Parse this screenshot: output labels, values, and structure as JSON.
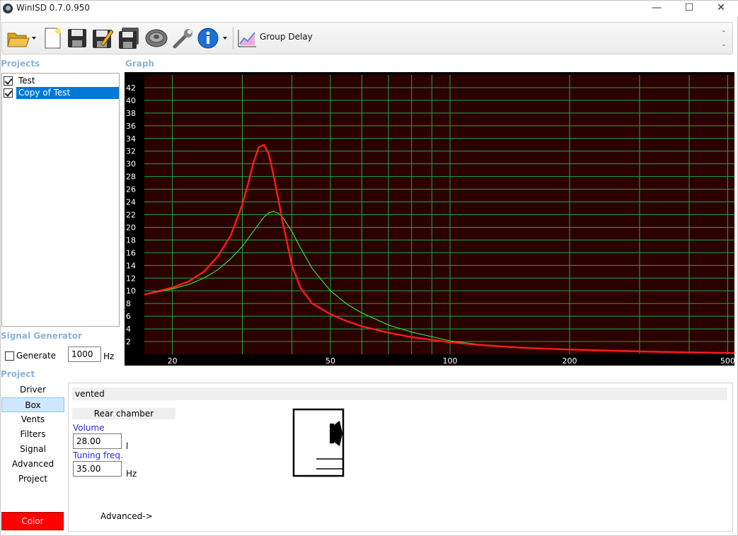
{
  "window": {
    "title": "WinISD 0.7.0.950",
    "minimize": "—",
    "maximize": "☐",
    "close": "✕"
  },
  "toolbar": {
    "group_delay_label": "Group Delay",
    "right_markers": [
      "-",
      "-"
    ],
    "icons": [
      "open-folder-icon",
      "new-document-icon",
      "save-icon",
      "save-as-icon",
      "save-all-icon",
      "speaker-driver-icon",
      "wrench-icon",
      "info-icon",
      "chart-icon"
    ]
  },
  "sections": {
    "projects": "Projects",
    "graph": "Graph",
    "signal_generator": "Signal Generator",
    "project": "Project"
  },
  "projects": [
    {
      "name": "Test",
      "checked": true,
      "selected": false
    },
    {
      "name": "Copy of Test",
      "checked": true,
      "selected": true
    }
  ],
  "signal_generator": {
    "generate_label": "Generate",
    "frequency": "1000",
    "unit": "Hz"
  },
  "nav": [
    "Driver",
    "Box",
    "Vents",
    "Filters",
    "Signal",
    "Advanced",
    "Project"
  ],
  "nav_selected": "Box",
  "color_button": "Color",
  "box": {
    "type": "vented",
    "rear_chamber": "Rear chamber",
    "volume_label": "Volume",
    "volume": "28.00",
    "volume_unit": "l",
    "tuning_label": "Tuning freq.",
    "tuning": "35.00",
    "tuning_unit": "Hz",
    "advanced": "Advanced->"
  },
  "colors": {
    "graph_bg": "#2a0000",
    "grid": "#1fa84a",
    "series_red": "#ff1a1a",
    "series_green": "#33e033",
    "accent": "#0078d7"
  },
  "chart_data": {
    "type": "line",
    "xscale": "log",
    "xlim": [
      17,
      520
    ],
    "ylim": [
      0,
      44
    ],
    "x_ticks": [
      20,
      50,
      100,
      200,
      500
    ],
    "y_ticks": [
      2,
      4,
      6,
      8,
      10,
      12,
      14,
      16,
      18,
      20,
      22,
      24,
      26,
      28,
      30,
      32,
      34,
      36,
      38,
      40,
      42
    ],
    "series": [
      {
        "color": "#ff1a1a",
        "x": [
          17,
          18,
          20,
          22,
          24,
          26,
          28,
          30,
          31,
          32,
          33,
          34,
          35,
          36,
          38,
          40,
          42,
          45,
          50,
          55,
          60,
          70,
          80,
          100,
          120,
          150,
          200,
          300,
          400,
          520
        ],
        "y": [
          9.4,
          9.8,
          10.5,
          11.5,
          13.0,
          15.4,
          18.6,
          23.6,
          26.8,
          30.2,
          32.6,
          33.0,
          31.5,
          28.0,
          20.5,
          14.0,
          10.5,
          8.0,
          6.3,
          5.2,
          4.4,
          3.4,
          2.7,
          1.9,
          1.45,
          1.05,
          0.75,
          0.45,
          0.3,
          0.2
        ]
      },
      {
        "color": "#33e033",
        "x": [
          17,
          18,
          20,
          22,
          24,
          26,
          28,
          30,
          32,
          34,
          35,
          36,
          37,
          38,
          40,
          42,
          45,
          50,
          55,
          60,
          70,
          80,
          100,
          120,
          150,
          200,
          300,
          400,
          520
        ],
        "y": [
          9.4,
          9.7,
          10.3,
          11.0,
          12.0,
          13.3,
          15.0,
          17.0,
          19.4,
          21.6,
          22.3,
          22.5,
          22.2,
          21.5,
          19.3,
          16.8,
          13.5,
          10.0,
          7.9,
          6.5,
          4.6,
          3.5,
          2.1,
          1.5,
          1.05,
          0.75,
          0.45,
          0.3,
          0.2
        ]
      }
    ]
  }
}
